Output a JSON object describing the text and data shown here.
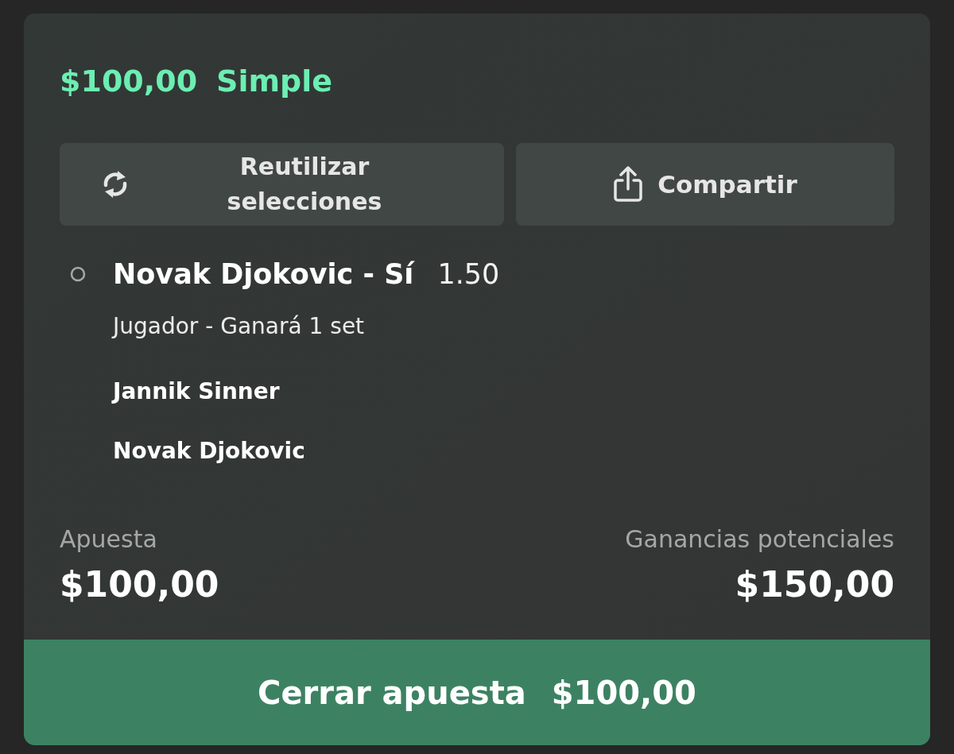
{
  "header": {
    "amount": "$100,00",
    "bet_type": "Simple"
  },
  "actions": [
    {
      "label": "Reutilizar selecciones",
      "kind": "reuse"
    },
    {
      "label": "Compartir",
      "kind": "share"
    }
  ],
  "selection": {
    "pick": "Novak Djokovic - Sí",
    "odds": "1.50",
    "market": "Jugador - Ganará 1 set",
    "participants": [
      "Jannik Sinner",
      "Novak Djokovic"
    ]
  },
  "summary": {
    "stake": {
      "label": "Apuesta",
      "value": "$100,00"
    },
    "potential_winnings": {
      "label": "Ganancias potenciales",
      "value": "$150,00"
    }
  },
  "cash_out_button": {
    "label": "Cerrar apuesta",
    "amount": "$100,00"
  }
}
